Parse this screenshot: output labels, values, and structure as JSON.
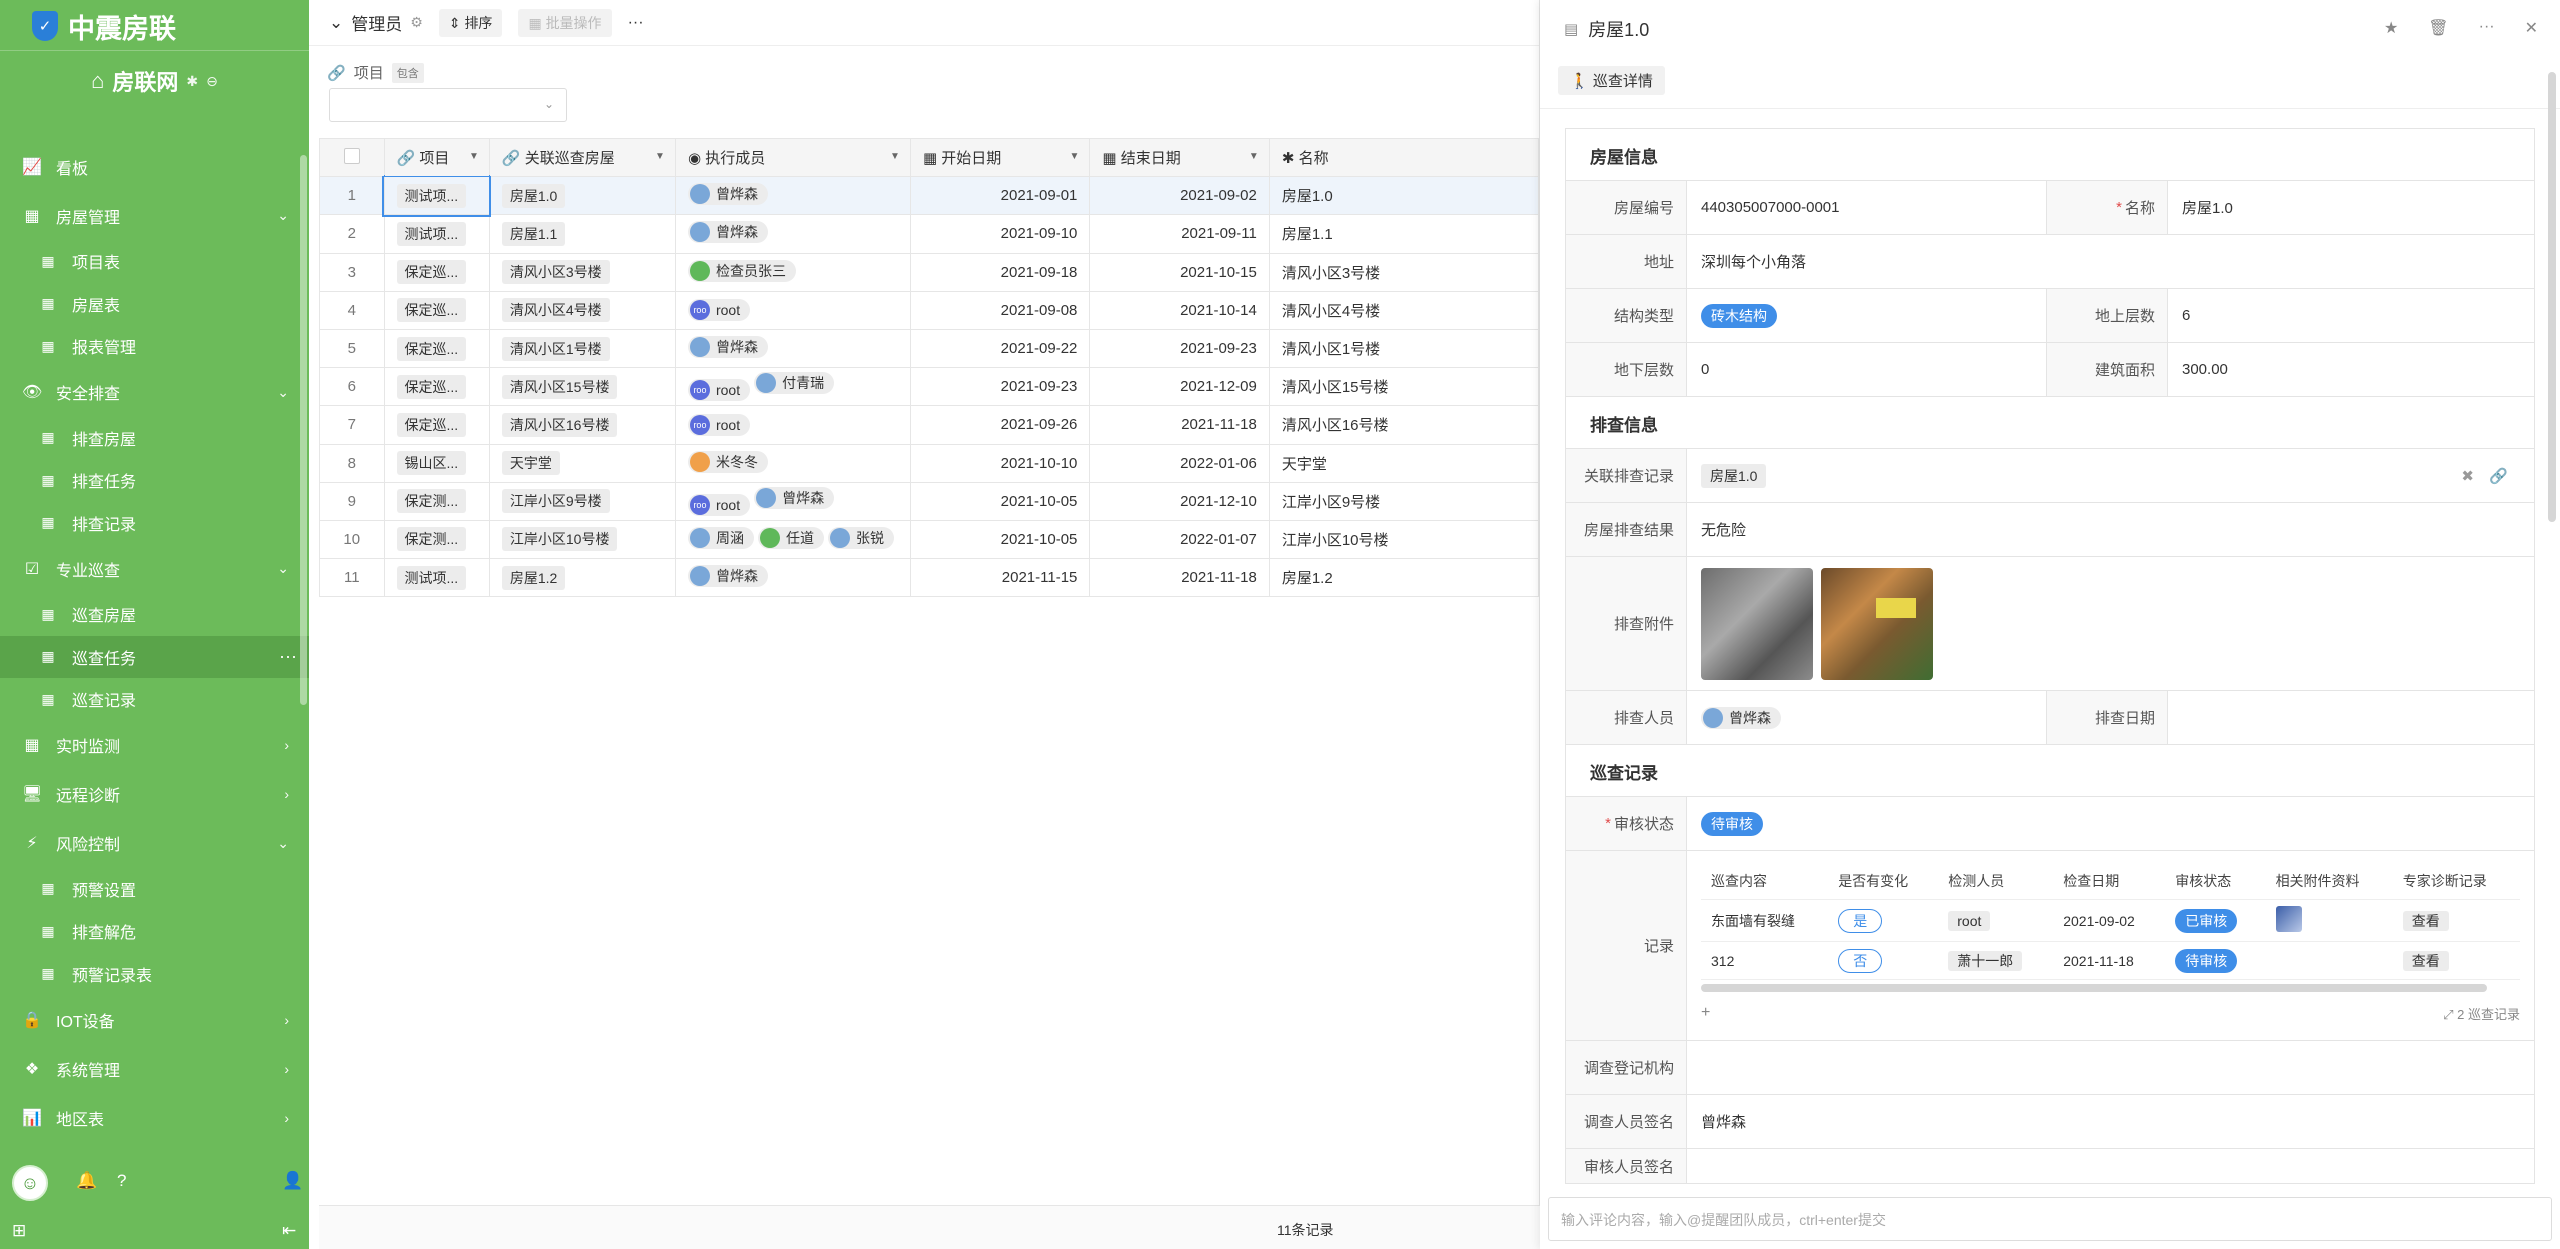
{
  "app": {
    "title": "中震房联",
    "workspace": "房联网"
  },
  "nav": [
    {
      "label": "看板",
      "icon": "chart-line-icon",
      "type": "top"
    },
    {
      "label": "房屋管理",
      "icon": "table-icon",
      "type": "group",
      "open": true
    },
    {
      "label": "项目表",
      "icon": "grid-icon",
      "type": "sub"
    },
    {
      "label": "房屋表",
      "icon": "grid-icon",
      "type": "sub"
    },
    {
      "label": "报表管理",
      "icon": "grid-icon",
      "type": "sub"
    },
    {
      "label": "安全排查",
      "icon": "eye-icon",
      "type": "group",
      "open": true
    },
    {
      "label": "排查房屋",
      "icon": "grid-icon",
      "type": "sub"
    },
    {
      "label": "排查任务",
      "icon": "grid-icon",
      "type": "sub"
    },
    {
      "label": "排查记录",
      "icon": "grid-icon",
      "type": "sub"
    },
    {
      "label": "专业巡查",
      "icon": "check-calendar-icon",
      "type": "group",
      "open": true
    },
    {
      "label": "巡查房屋",
      "icon": "grid-icon",
      "type": "sub"
    },
    {
      "label": "巡查任务",
      "icon": "grid-icon",
      "type": "sub",
      "active": true
    },
    {
      "label": "巡查记录",
      "icon": "grid-icon",
      "type": "sub"
    },
    {
      "label": "实时监测",
      "icon": "table-icon",
      "type": "group",
      "open": false
    },
    {
      "label": "远程诊断",
      "icon": "monitor-icon",
      "type": "group",
      "open": false
    },
    {
      "label": "风险控制",
      "icon": "bolt-icon",
      "type": "group",
      "open": true
    },
    {
      "label": "预警设置",
      "icon": "grid-icon",
      "type": "sub"
    },
    {
      "label": "排查解危",
      "icon": "grid-icon",
      "type": "sub"
    },
    {
      "label": "预警记录表",
      "icon": "grid-icon",
      "type": "sub"
    },
    {
      "label": "IOT设备",
      "icon": "lock-icon",
      "type": "group",
      "open": false
    },
    {
      "label": "系统管理",
      "icon": "cubes-icon",
      "type": "group",
      "open": false
    },
    {
      "label": "地区表",
      "icon": "area-chart-icon",
      "type": "group",
      "open": false
    }
  ],
  "toolbar": {
    "view": "管理员",
    "sort": "排序",
    "batch": "批量操作",
    "more": "···"
  },
  "filter": {
    "label": "项目",
    "tag": "包含"
  },
  "table": {
    "headers": [
      "项目",
      "关联巡查房屋",
      "执行成员",
      "开始日期",
      "结束日期",
      "名称"
    ],
    "rows": [
      {
        "n": "1",
        "project": "测试项...",
        "house": "房屋1.0",
        "members": [
          "曾烨森"
        ],
        "start": "2021-09-01",
        "end": "2021-09-02",
        "name": "房屋1.0"
      },
      {
        "n": "2",
        "project": "测试项...",
        "house": "房屋1.1",
        "members": [
          "曾烨森"
        ],
        "start": "2021-09-10",
        "end": "2021-09-11",
        "name": "房屋1.1"
      },
      {
        "n": "3",
        "project": "保定巡...",
        "house": "清风小区3号楼",
        "members": [
          "检查员张三"
        ],
        "start": "2021-09-18",
        "end": "2021-10-15",
        "name": "清风小区3号楼"
      },
      {
        "n": "4",
        "project": "保定巡...",
        "house": "清风小区4号楼",
        "members": [
          "root"
        ],
        "start": "2021-09-08",
        "end": "2021-10-14",
        "name": "清风小区4号楼"
      },
      {
        "n": "5",
        "project": "保定巡...",
        "house": "清风小区1号楼",
        "members": [
          "曾烨森"
        ],
        "start": "2021-09-22",
        "end": "2021-09-23",
        "name": "清风小区1号楼"
      },
      {
        "n": "6",
        "project": "保定巡...",
        "house": "清风小区15号楼",
        "members": [
          "root",
          "付青瑞"
        ],
        "start": "2021-09-23",
        "end": "2021-12-09",
        "name": "清风小区15号楼"
      },
      {
        "n": "7",
        "project": "保定巡...",
        "house": "清风小区16号楼",
        "members": [
          "root"
        ],
        "start": "2021-09-26",
        "end": "2021-11-18",
        "name": "清风小区16号楼"
      },
      {
        "n": "8",
        "project": "锡山区...",
        "house": "天宇堂",
        "members": [
          "米冬冬"
        ],
        "start": "2021-10-10",
        "end": "2022-01-06",
        "name": "天宇堂"
      },
      {
        "n": "9",
        "project": "保定测...",
        "house": "江岸小区9号楼",
        "members": [
          "root",
          "曾烨森"
        ],
        "start": "2021-10-05",
        "end": "2021-12-10",
        "name": "江岸小区9号楼"
      },
      {
        "n": "10",
        "project": "保定测...",
        "house": "江岸小区10号楼",
        "members": [
          "周涵",
          "任道",
          "张锐"
        ],
        "start": "2021-10-05",
        "end": "2022-01-07",
        "name": "江岸小区10号楼"
      },
      {
        "n": "11",
        "project": "测试项...",
        "house": "房屋1.2",
        "members": [
          "曾烨森"
        ],
        "start": "2021-11-15",
        "end": "2021-11-18",
        "name": "房屋1.2"
      }
    ],
    "footer": "11条记录"
  },
  "detail": {
    "title": "房屋1.0",
    "tab": "巡查详情",
    "sec_house": "房屋信息",
    "house_no_label": "房屋编号",
    "house_no": "440305007000-0001",
    "name_label": "名称",
    "name": "房屋1.0",
    "addr_label": "地址",
    "addr": "深圳每个小角落",
    "struct_label": "结构类型",
    "struct": "砖木结构",
    "floors_up_label": "地上层数",
    "floors_up": "6",
    "floors_down_label": "地下层数",
    "floors_down": "0",
    "area_label": "建筑面积",
    "area": "300.00",
    "sec_check": "排查信息",
    "rel_label": "关联排查记录",
    "rel": "房屋1.0",
    "result_label": "房屋排查结果",
    "result": "无危险",
    "attach_label": "排查附件",
    "checker_label": "排查人员",
    "checker": "曾烨森",
    "check_date_label": "排查日期",
    "sec_patrol": "巡查记录",
    "audit_label": "审核状态",
    "audit": "待审核",
    "records_label": "记录",
    "sub_headers": [
      "巡查内容",
      "是否有变化",
      "检测人员",
      "检查日期",
      "审核状态",
      "相关附件资料",
      "专家诊断记录"
    ],
    "sub_rows": [
      {
        "content": "东面墙有裂缝",
        "changed": "是",
        "inspector": "root",
        "date": "2021-09-02",
        "status": "已审核",
        "action": "查看"
      },
      {
        "content": "312",
        "changed": "否",
        "inspector": "萧十一郎",
        "date": "2021-11-18",
        "status": "待审核",
        "action": "查看"
      }
    ],
    "sub_count": "2 巡查记录",
    "org_label": "调查登记机构",
    "sign_label": "调查人员签名",
    "sign": "曾烨森",
    "audit_sign_label": "审核人员签名",
    "comment_placeholder": "输入评论内容，输入@提醒团队成员，ctrl+enter提交"
  }
}
